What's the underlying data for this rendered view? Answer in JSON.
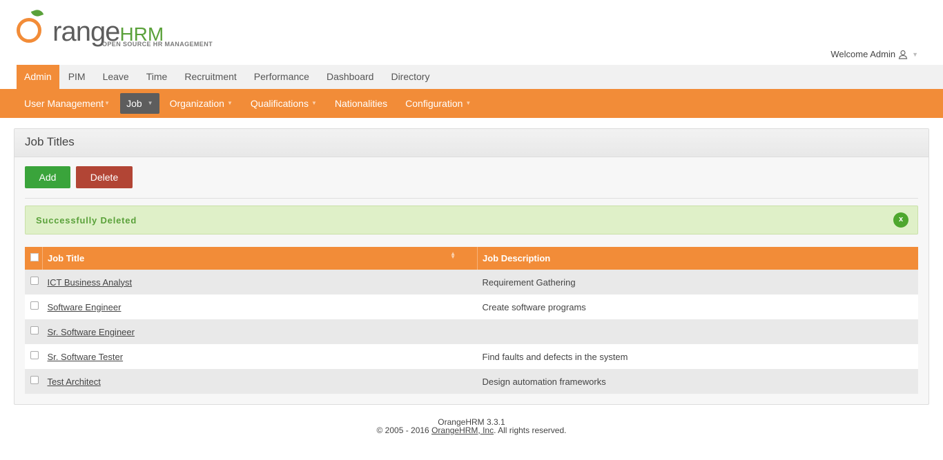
{
  "brand": {
    "logo_prefix": "O",
    "logo_word": "range",
    "logo_hrm": "HRM",
    "tagline": "OPEN SOURCE HR MANAGEMENT"
  },
  "header": {
    "welcome": "Welcome Admin"
  },
  "top_nav": [
    {
      "label": "Admin",
      "active": true
    },
    {
      "label": "PIM"
    },
    {
      "label": "Leave"
    },
    {
      "label": "Time"
    },
    {
      "label": "Recruitment"
    },
    {
      "label": "Performance"
    },
    {
      "label": "Dashboard"
    },
    {
      "label": "Directory"
    }
  ],
  "sub_nav": [
    {
      "label": "User Management"
    },
    {
      "label": "Job",
      "active": true
    },
    {
      "label": "Organization"
    },
    {
      "label": "Qualifications"
    },
    {
      "label": "Nationalities"
    },
    {
      "label": "Configuration"
    }
  ],
  "panel": {
    "title": "Job Titles",
    "add_label": "Add",
    "delete_label": "Delete",
    "message": "Successfully Deleted",
    "close_label": "x"
  },
  "table": {
    "headers": [
      "Job Title",
      "Job Description"
    ],
    "rows": [
      {
        "title": "ICT Business Analyst",
        "description": "Requirement Gathering"
      },
      {
        "title": "Software Engineer",
        "description": "Create software programs"
      },
      {
        "title": "Sr. Software Engineer",
        "description": ""
      },
      {
        "title": "Sr. Software Tester",
        "description": "Find faults and defects in the system"
      },
      {
        "title": "Test Architect",
        "description": "Design automation frameworks"
      }
    ]
  },
  "footer": {
    "version": "OrangeHRM 3.3.1",
    "copyright_prefix": "© 2005 - 2016 ",
    "company_link": "OrangeHRM, Inc",
    "copyright_suffix": ". All rights reserved."
  },
  "colors": {
    "accent": "#f28c38",
    "success": "#3aa43b",
    "danger": "#b24535",
    "brand_green": "#5aa13a"
  }
}
